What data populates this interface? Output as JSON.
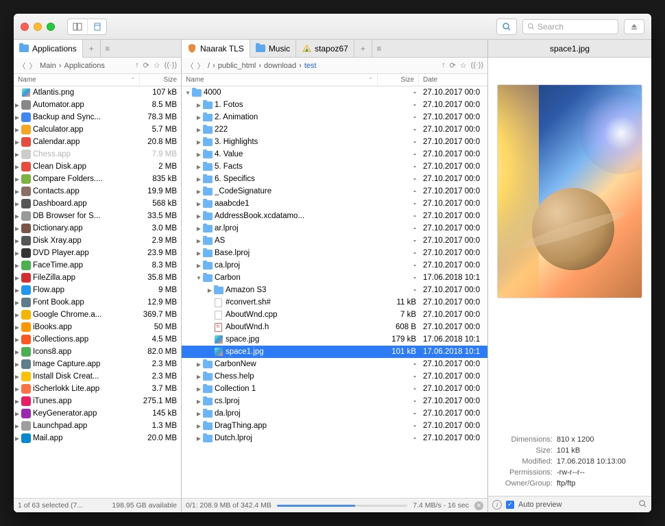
{
  "toolbar": {
    "search_placeholder": "Search"
  },
  "left": {
    "tabs": [
      {
        "label": "Applications"
      }
    ],
    "path": [
      "Main",
      "Applications"
    ],
    "columns": [
      "Name",
      "Size"
    ],
    "status": {
      "selected": "1 of 63 selected (7...",
      "free": "198.95 GB available"
    },
    "files": [
      {
        "n": "Atlantis.png",
        "s": "107 kB",
        "t": "img",
        "c": "#8ac"
      },
      {
        "n": "Automator.app",
        "s": "8.5 MB",
        "t": "app",
        "c": "#888",
        "exp": true
      },
      {
        "n": "Backup and Sync...",
        "s": "78.3 MB",
        "t": "app",
        "c": "#4285f4",
        "exp": true
      },
      {
        "n": "Calculator.app",
        "s": "5.7 MB",
        "t": "app",
        "c": "#f5a623",
        "exp": true
      },
      {
        "n": "Calendar.app",
        "s": "20.8 MB",
        "t": "app",
        "c": "#e74c3c",
        "exp": true
      },
      {
        "n": "Chess.app",
        "s": "7.9 MB",
        "t": "app",
        "c": "#ccc",
        "exp": true,
        "dim": true
      },
      {
        "n": "Clean Disk.app",
        "s": "2 MB",
        "t": "app",
        "c": "#e74c3c",
        "exp": true
      },
      {
        "n": "Compare Folders....",
        "s": "835 kB",
        "t": "app",
        "c": "#7cb342",
        "exp": true
      },
      {
        "n": "Contacts.app",
        "s": "19.9 MB",
        "t": "app",
        "c": "#8d6e63",
        "exp": true
      },
      {
        "n": "Dashboard.app",
        "s": "568 kB",
        "t": "app",
        "c": "#555",
        "exp": true
      },
      {
        "n": "DB Browser for S...",
        "s": "33.5 MB",
        "t": "app",
        "c": "#999",
        "exp": true
      },
      {
        "n": "Dictionary.app",
        "s": "3.0 MB",
        "t": "app",
        "c": "#795548",
        "exp": true
      },
      {
        "n": "Disk Xray.app",
        "s": "2.9 MB",
        "t": "app",
        "c": "#555",
        "exp": true
      },
      {
        "n": "DVD Player.app",
        "s": "23.9 MB",
        "t": "app",
        "c": "#333",
        "exp": true
      },
      {
        "n": "FaceTime.app",
        "s": "8.3 MB",
        "t": "app",
        "c": "#4caf50",
        "exp": true
      },
      {
        "n": "FileZilla.app",
        "s": "35.8 MB",
        "t": "app",
        "c": "#d32f2f",
        "exp": true
      },
      {
        "n": "Flow.app",
        "s": "9 MB",
        "t": "app",
        "c": "#2196f3",
        "exp": true
      },
      {
        "n": "Font Book.app",
        "s": "12.9 MB",
        "t": "app",
        "c": "#607d8b",
        "exp": true
      },
      {
        "n": "Google Chrome.a...",
        "s": "369.7 MB",
        "t": "app",
        "c": "#f4b400",
        "exp": true
      },
      {
        "n": "iBooks.app",
        "s": "50 MB",
        "t": "app",
        "c": "#ff9800",
        "exp": true
      },
      {
        "n": "iCollections.app",
        "s": "4.5 MB",
        "t": "app",
        "c": "#ff5722",
        "exp": true
      },
      {
        "n": "Icons8.app",
        "s": "82.0 MB",
        "t": "app",
        "c": "#4caf50",
        "exp": true
      },
      {
        "n": "Image Capture.app",
        "s": "2.3 MB",
        "t": "app",
        "c": "#607d8b",
        "exp": true
      },
      {
        "n": "Install Disk Creat...",
        "s": "2.3 MB",
        "t": "app",
        "c": "#ffc107",
        "exp": true
      },
      {
        "n": "iScherlokk Lite.app",
        "s": "3.7 MB",
        "t": "app",
        "c": "#ff7043",
        "exp": true
      },
      {
        "n": "iTunes.app",
        "s": "275.1 MB",
        "t": "app",
        "c": "#e91e63",
        "exp": true
      },
      {
        "n": "KeyGenerator.app",
        "s": "145 kB",
        "t": "app",
        "c": "#9c27b0",
        "exp": true
      },
      {
        "n": "Launchpad.app",
        "s": "1.3 MB",
        "t": "app",
        "c": "#9e9e9e",
        "exp": true
      },
      {
        "n": "Mail.app",
        "s": "20.0 MB",
        "t": "app",
        "c": "#0288d1",
        "exp": true
      }
    ]
  },
  "mid": {
    "tabs": [
      {
        "label": "Naarak TLS"
      },
      {
        "label": "Music"
      },
      {
        "label": "stapoz67"
      }
    ],
    "path": [
      "/",
      "public_html",
      "download",
      "test"
    ],
    "columns": [
      "Name",
      "Size",
      "Date"
    ],
    "status": {
      "transfer": "0/1: 208.9 MB of 342.4 MB",
      "speed": "7.4 MB/s - 16 sec"
    },
    "files": [
      {
        "n": "4000",
        "s": "-",
        "d": "27.10.2017 00:0",
        "t": "folder",
        "i": 0,
        "open": true
      },
      {
        "n": "1. Fotos",
        "s": "-",
        "d": "27.10.2017 00:0",
        "t": "folder",
        "i": 1,
        "exp": true
      },
      {
        "n": "2. Animation",
        "s": "-",
        "d": "27.10.2017 00:0",
        "t": "folder",
        "i": 1,
        "exp": true
      },
      {
        "n": "222",
        "s": "-",
        "d": "27.10.2017 00:0",
        "t": "folder",
        "i": 1,
        "exp": true
      },
      {
        "n": "3. Highlights",
        "s": "-",
        "d": "27.10.2017 00:0",
        "t": "folder",
        "i": 1,
        "exp": true
      },
      {
        "n": "4. Value",
        "s": "-",
        "d": "27.10.2017 00:0",
        "t": "folder",
        "i": 1,
        "exp": true
      },
      {
        "n": "5. Facts",
        "s": "-",
        "d": "27.10.2017 00:0",
        "t": "folder",
        "i": 1,
        "exp": true
      },
      {
        "n": "6. Specifics",
        "s": "-",
        "d": "27.10.2017 00:0",
        "t": "folder",
        "i": 1,
        "exp": true
      },
      {
        "n": "_CodeSignature",
        "s": "-",
        "d": "27.10.2017 00:0",
        "t": "folder",
        "i": 1,
        "exp": true
      },
      {
        "n": "aaabcde1",
        "s": "-",
        "d": "27.10.2017 00:0",
        "t": "folder",
        "i": 1,
        "exp": true
      },
      {
        "n": "AddressBook.xcdatamo...",
        "s": "-",
        "d": "27.10.2017 00:0",
        "t": "folder",
        "i": 1,
        "exp": true
      },
      {
        "n": "ar.lproj",
        "s": "-",
        "d": "27.10.2017 00:0",
        "t": "folder",
        "i": 1,
        "exp": true
      },
      {
        "n": "AS",
        "s": "-",
        "d": "27.10.2017 00:0",
        "t": "folder",
        "i": 1,
        "exp": true
      },
      {
        "n": "Base.lproj",
        "s": "-",
        "d": "27.10.2017 00:0",
        "t": "folder",
        "i": 1,
        "exp": true
      },
      {
        "n": "ca.lproj",
        "s": "-",
        "d": "27.10.2017 00:0",
        "t": "folder",
        "i": 1,
        "exp": true
      },
      {
        "n": "Carbon",
        "s": "-",
        "d": "17.06.2018 10:1",
        "t": "folder",
        "i": 1,
        "open": true
      },
      {
        "n": "Amazon S3",
        "s": "-",
        "d": "27.10.2017 00:0",
        "t": "folder",
        "i": 2,
        "exp": true
      },
      {
        "n": "#convert.sh#",
        "s": "11 kB",
        "d": "27.10.2017 00:0",
        "t": "file",
        "i": 2
      },
      {
        "n": "AboutWnd.cpp",
        "s": "7 kB",
        "d": "27.10.2017 00:0",
        "t": "file",
        "i": 2
      },
      {
        "n": "AboutWnd.h",
        "s": "608 B",
        "d": "27.10.2017 00:0",
        "t": "hfile",
        "i": 2
      },
      {
        "n": "space.jpg",
        "s": "179 kB",
        "d": "17.06.2018 10:1",
        "t": "img",
        "i": 2
      },
      {
        "n": "space1.jpg",
        "s": "101 kB",
        "d": "17.06.2018 10:1",
        "t": "img",
        "i": 2,
        "sel": true
      },
      {
        "n": "CarbonNew",
        "s": "-",
        "d": "27.10.2017 00:0",
        "t": "folder",
        "i": 1,
        "exp": true
      },
      {
        "n": "Chess.help",
        "s": "-",
        "d": "27.10.2017 00:0",
        "t": "folder",
        "i": 1,
        "exp": true
      },
      {
        "n": "Collection 1",
        "s": "-",
        "d": "27.10.2017 00:0",
        "t": "folder",
        "i": 1,
        "exp": true
      },
      {
        "n": "cs.lproj",
        "s": "-",
        "d": "27.10.2017 00:0",
        "t": "folder",
        "i": 1,
        "exp": true
      },
      {
        "n": "da.lproj",
        "s": "-",
        "d": "27.10.2017 00:0",
        "t": "folder",
        "i": 1,
        "exp": true
      },
      {
        "n": "DragThing.app",
        "s": "-",
        "d": "27.10.2017 00:0",
        "t": "folder",
        "i": 1,
        "exp": true
      },
      {
        "n": "Dutch.lproj",
        "s": "-",
        "d": "27.10.2017 00:0",
        "t": "folder",
        "i": 1,
        "exp": true
      }
    ]
  },
  "preview": {
    "filename": "space1.jpg",
    "auto_label": "Auto preview",
    "meta": [
      {
        "label": "Dimensions:",
        "value": "810 x 1200"
      },
      {
        "label": "Size:",
        "value": "101 kB"
      },
      {
        "label": "Modified:",
        "value": "17.06.2018 10:13:00"
      },
      {
        "label": "Permissions:",
        "value": "-rw-r--r--"
      },
      {
        "label": "Owner/Group:",
        "value": "ftp/ftp"
      }
    ]
  }
}
